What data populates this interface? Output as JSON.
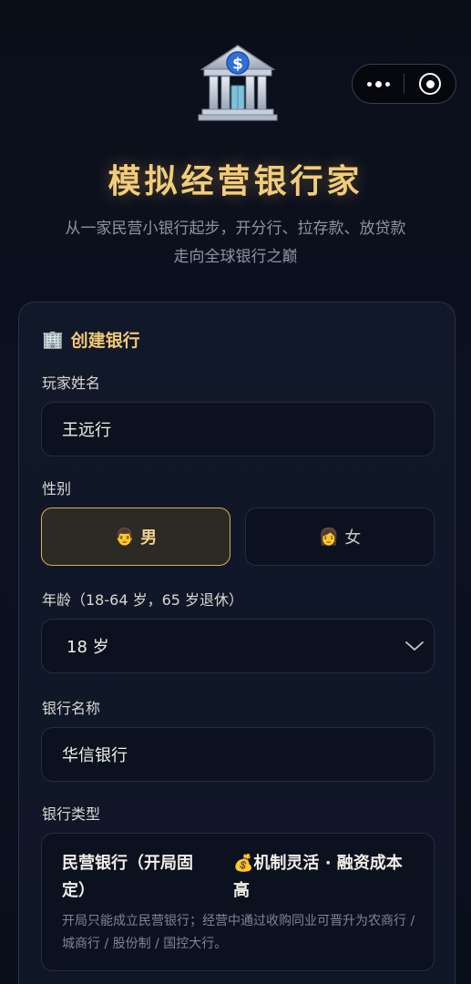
{
  "header": {
    "title": "模拟经营银行家",
    "subtitle_line1": "从一家民营小银行起步，开分行、拉存款、放贷款",
    "subtitle_line2": "走向全球银行之巅"
  },
  "form": {
    "section_icon": "🏢",
    "section_title": "创建银行",
    "player_name": {
      "label": "玩家姓名",
      "value": "王远行"
    },
    "gender": {
      "label": "性别",
      "options": [
        {
          "icon": "👨",
          "label": "男",
          "selected": true
        },
        {
          "icon": "👩",
          "label": "女",
          "selected": false
        }
      ]
    },
    "age": {
      "label": "年龄（18-64 岁，65 岁退休）",
      "value": "18 岁"
    },
    "bank_name": {
      "label": "银行名称",
      "value": "华信银行"
    },
    "bank_type": {
      "label": "银行类型",
      "name": "民营银行（开局固定）",
      "feature_icon": "💰",
      "feature": "机制灵活 · 融资成本高",
      "description": "开局只能成立民营银行；经营中通过收购同业可晋升为农商行 / 城商行 / 股份制 / 国控大行。"
    }
  },
  "colors": {
    "accent_gold": "#f3cc7a",
    "selected_border": "#d9ad55",
    "background": "#0b0f1a"
  },
  "icons": [
    "bank-logo-icon",
    "more-dots-icon",
    "close-target-icon",
    "building-icon",
    "chevron-down-icon",
    "money-bag-icon"
  ]
}
